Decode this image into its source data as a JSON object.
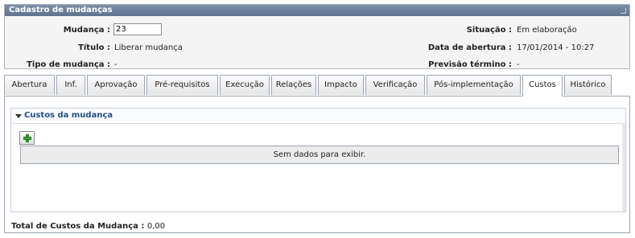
{
  "panel": {
    "title": "Cadastro de mudanças",
    "mudanca_label": "Mudança :",
    "mudanca_value": "23",
    "titulo_label": "Título :",
    "titulo_value": "Liberar mudança",
    "tipo_label": "Tipo de mudança :",
    "tipo_value": "-",
    "situacao_label": "Situação :",
    "situacao_value": "Em elaboração",
    "data_label": "Data de abertura :",
    "data_value": "17/01/2014 - 10:27",
    "previsao_label": "Previsão término :",
    "previsao_value": "-"
  },
  "tabs": [
    {
      "label": "Abertura"
    },
    {
      "label": "Inf."
    },
    {
      "label": "Aprovação"
    },
    {
      "label": "Pré-requisitos"
    },
    {
      "label": "Execução"
    },
    {
      "label": "Relações"
    },
    {
      "label": "Impacto"
    },
    {
      "label": "Verificação"
    },
    {
      "label": "Pós-implementação"
    },
    {
      "label": "Custos"
    },
    {
      "label": "Histórico"
    }
  ],
  "active_tab": "Custos",
  "costs": {
    "section_title": "Custos da mudança",
    "empty_text": "Sem dados para exibir.",
    "add_icon": "plus-icon"
  },
  "total": {
    "label": "Total de Custos da Mudança :",
    "value": "0,00"
  }
}
